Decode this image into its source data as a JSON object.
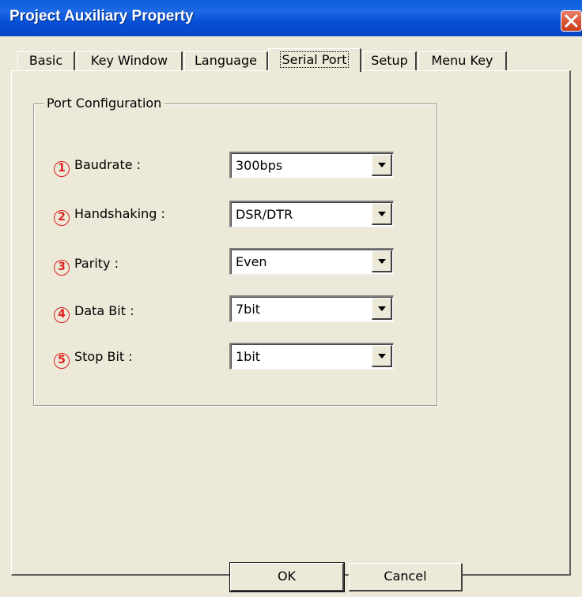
{
  "window": {
    "title": "Project Auxiliary Property",
    "close_icon": "close-icon"
  },
  "tabs": [
    {
      "label": "Basic"
    },
    {
      "label": "Key Window"
    },
    {
      "label": "Language"
    },
    {
      "label": "Serial Port",
      "active": true
    },
    {
      "label": "Setup"
    },
    {
      "label": "Menu Key"
    }
  ],
  "group": {
    "legend": "Port Configuration",
    "rows": [
      {
        "num": "1",
        "label": "Baudrate :",
        "value": "300bps"
      },
      {
        "num": "2",
        "label": "Handshaking :",
        "value": "DSR/DTR"
      },
      {
        "num": "3",
        "label": "Parity :",
        "value": "Even"
      },
      {
        "num": "4",
        "label": "Data Bit :",
        "value": "7bit"
      },
      {
        "num": "5",
        "label": "Stop Bit :",
        "value": "1bit"
      }
    ]
  },
  "buttons": {
    "ok": "OK",
    "cancel": "Cancel"
  },
  "colors": {
    "titlebar": "#0550d8",
    "close": "#d4502f",
    "face": "#ece9d8",
    "number": "#e02020"
  }
}
